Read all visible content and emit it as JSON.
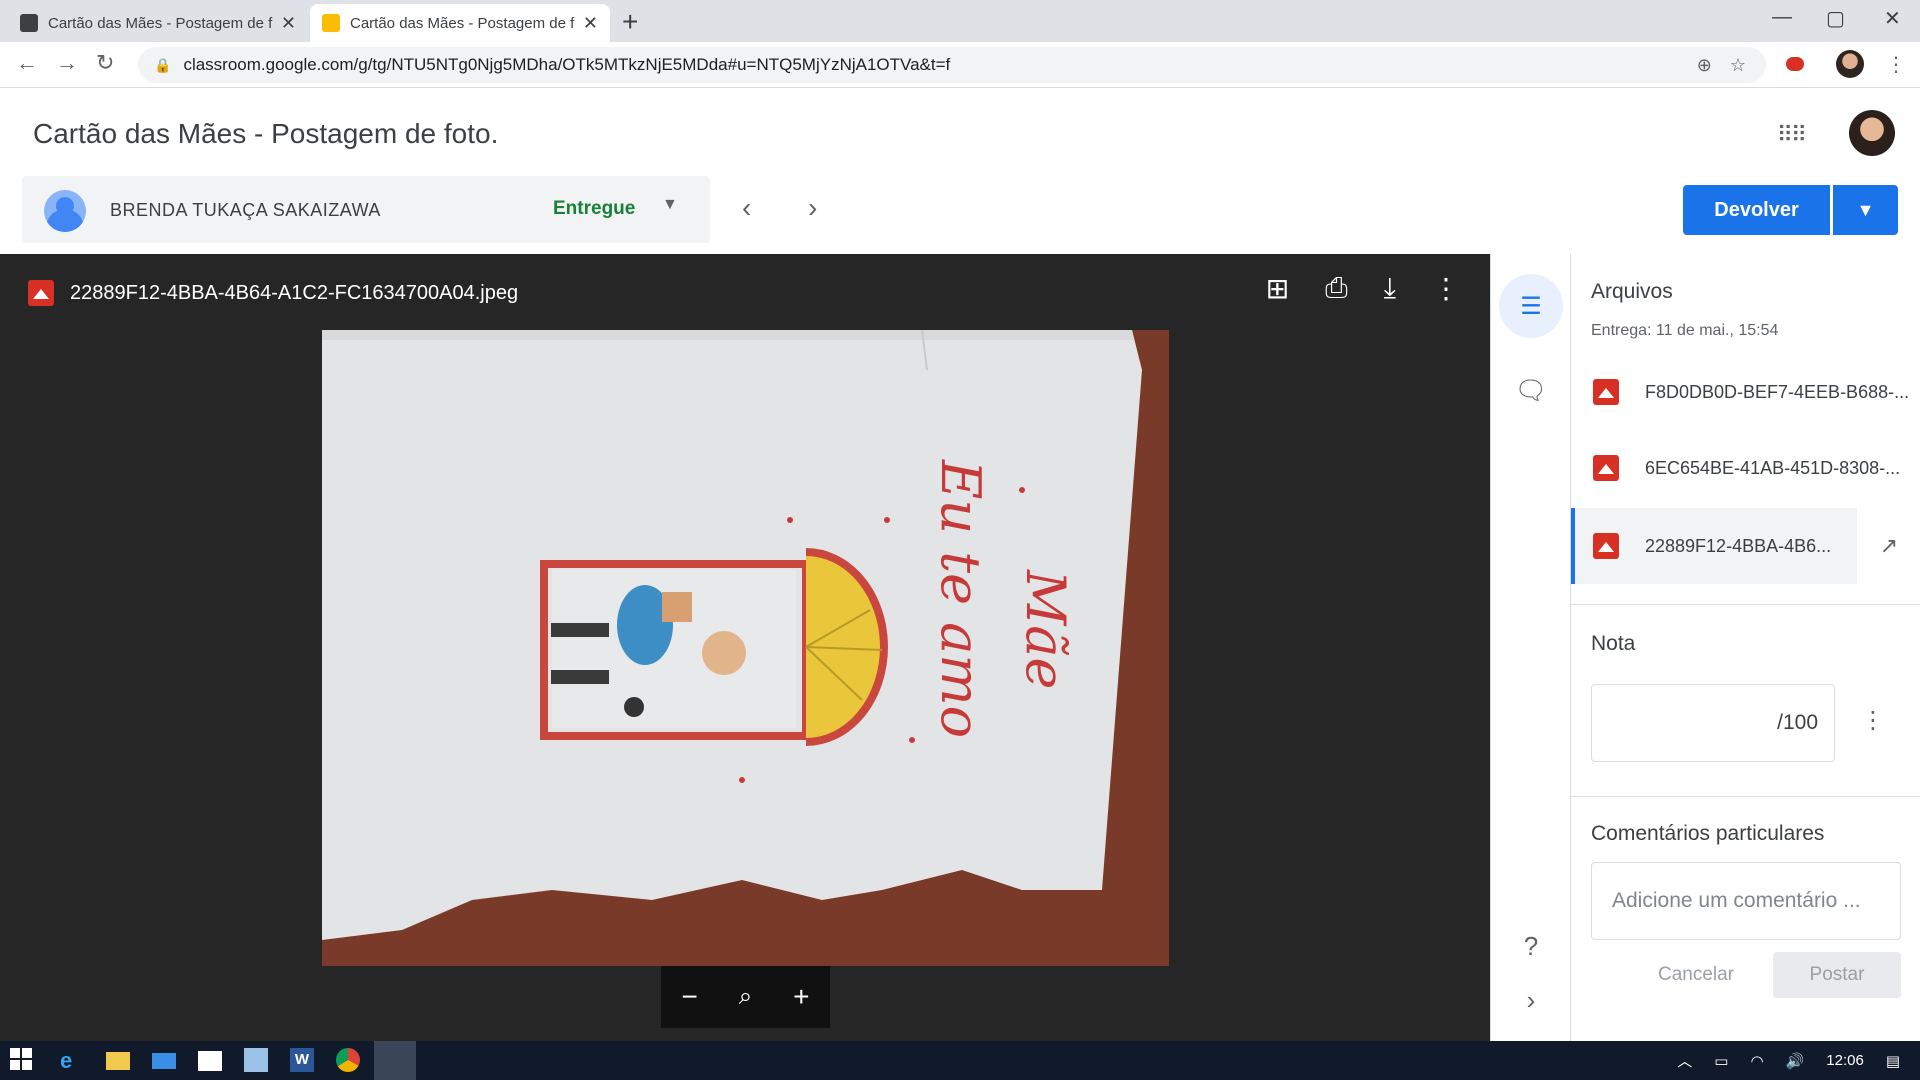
{
  "browser": {
    "tabs": [
      {
        "title": "Cartão das Mães - Postagem de f",
        "active": false
      },
      {
        "title": "Cartão das Mães - Postagem de f",
        "active": true
      }
    ],
    "new_tab": "+",
    "url": "classroom.google.com/g/tg/NTU5NTg0Njg5MDha/OTk5MTkzNjE5MDda#u=NTQ5MjYzNjA1OTVa&t=f",
    "window_controls": {
      "minimize": "—",
      "maximize": "▢",
      "close": "✕"
    }
  },
  "header": {
    "title": "Cartão das Mães - Postagem de foto."
  },
  "student": {
    "name": "BRENDA TUKAÇA SAKAIZAWA",
    "status": "Entregue",
    "status_color": "#188038"
  },
  "actions": {
    "return_label": "Devolver",
    "accent": "#1a73e8"
  },
  "viewer": {
    "file_name": "22889F12-4BBA-4B64-A1C2-FC1634700A04.jpeg",
    "photo_text": "Mãe Eu te amo"
  },
  "panel": {
    "files_title": "Arquivos",
    "submitted": "Entrega: 11 de mai., 15:54",
    "files": [
      {
        "name": "F8D0DB0D-BEF7-4EEB-B688-..."
      },
      {
        "name": "6EC654BE-41AB-451D-8308-..."
      },
      {
        "name": "22889F12-4BBA-4B6..."
      }
    ],
    "grade_title": "Nota",
    "grade_suffix": "/100",
    "comments_title": "Comentários particulares",
    "comment_placeholder": "Adicione um comentário ...",
    "cancel_label": "Cancelar",
    "post_label": "Postar"
  },
  "taskbar": {
    "time": "12:06"
  }
}
